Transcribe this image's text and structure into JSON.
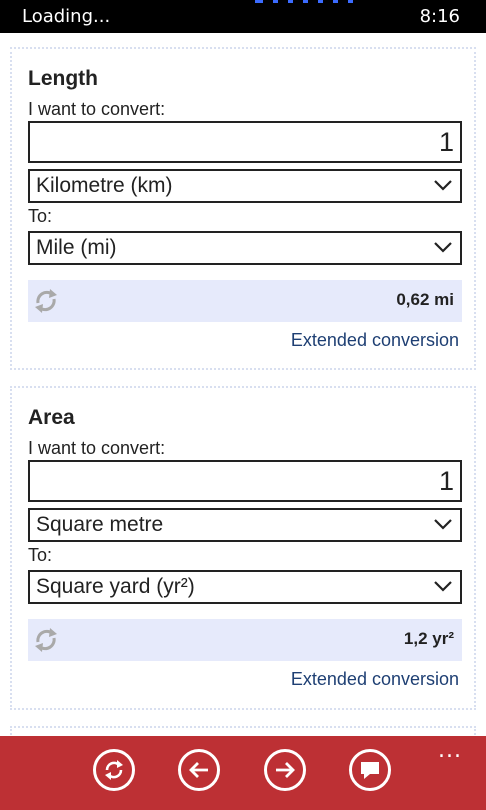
{
  "status_bar": {
    "left_text": "Loading...",
    "time": "8:16"
  },
  "cards": [
    {
      "title": "Length",
      "from_label": "I want to convert:",
      "input_value": "1",
      "from_unit": "Kilometre (km)",
      "to_label": "To:",
      "to_unit": "Mile (mi)",
      "result": "0,62 mi",
      "extended_link": "Extended conversion"
    },
    {
      "title": "Area",
      "from_label": "I want to convert:",
      "input_value": "1",
      "from_unit": "Square metre",
      "to_label": "To:",
      "to_unit": "Square yard (yr²)",
      "result": "1,2 yr²",
      "extended_link": "Extended conversion"
    }
  ],
  "app_bar": {
    "buttons": [
      "refresh-icon",
      "back-arrow-icon",
      "forward-arrow-icon",
      "comment-icon"
    ],
    "more_label": "...",
    "color": "#bd3034"
  },
  "accent_color": "#1e3f73"
}
